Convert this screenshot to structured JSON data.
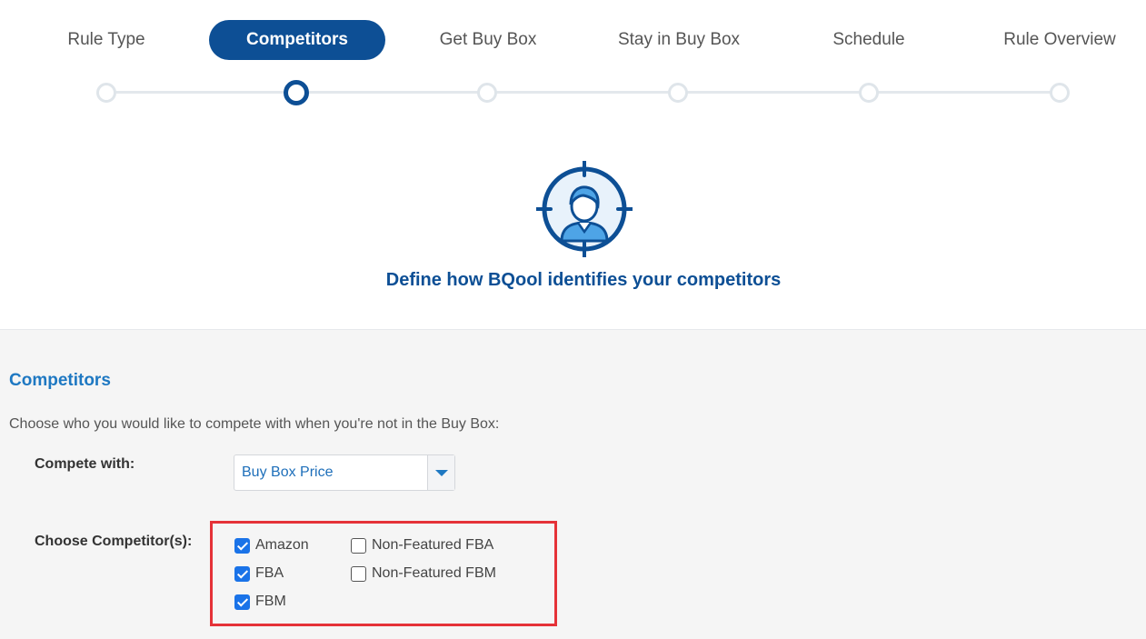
{
  "stepper": {
    "steps": [
      {
        "label": "Rule Type",
        "active": false
      },
      {
        "label": "Competitors",
        "active": true
      },
      {
        "label": "Get Buy Box",
        "active": false
      },
      {
        "label": "Stay in Buy Box",
        "active": false
      },
      {
        "label": "Schedule",
        "active": false
      },
      {
        "label": "Rule Overview",
        "active": false
      }
    ]
  },
  "hero": {
    "icon": "competitor-target-icon",
    "title": "Define how BQool identifies your competitors"
  },
  "section": {
    "title": "Competitors",
    "description": "Choose who you would like to compete with when you're not in the Buy Box:",
    "compete_with": {
      "label": "Compete with:",
      "selected": "Buy Box Price"
    },
    "choose_competitors": {
      "label": "Choose Competitor(s):",
      "options": [
        {
          "label": "Amazon",
          "checked": true
        },
        {
          "label": "FBA",
          "checked": true
        },
        {
          "label": "FBM",
          "checked": true
        },
        {
          "label": "Non-Featured FBA",
          "checked": false
        },
        {
          "label": "Non-Featured FBM",
          "checked": false
        }
      ]
    }
  },
  "colors": {
    "primary": "#0d4f95",
    "accent": "#1e78c2",
    "checkbox": "#1a73e8",
    "highlight_border": "#e53238"
  }
}
